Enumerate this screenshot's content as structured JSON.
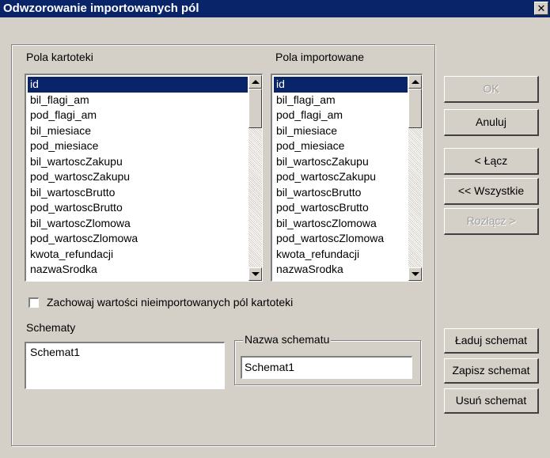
{
  "window": {
    "title": "Odwzorowanie importowanych pól",
    "close_glyph": "✕"
  },
  "fields_list": {
    "label": "Pola kartoteki",
    "items": [
      "id",
      "bil_flagi_am",
      "pod_flagi_am",
      "bil_miesiace",
      "pod_miesiace",
      "bil_wartoscZakupu",
      "pod_wartoscZakupu",
      "bil_wartoscBrutto",
      "pod_wartoscBrutto",
      "bil_wartoscZlomowa",
      "pod_wartoscZlomowa",
      "kwota_refundacji",
      "nazwaSrodka"
    ],
    "selected_index": 0
  },
  "imported_list": {
    "label": "Pola importowane",
    "items": [
      "id",
      "bil_flagi_am",
      "pod_flagi_am",
      "bil_miesiace",
      "pod_miesiace",
      "bil_wartoscZakupu",
      "pod_wartoscZakupu",
      "bil_wartoscBrutto",
      "pod_wartoscBrutto",
      "bil_wartoscZlomowa",
      "pod_wartoscZlomowa",
      "kwota_refundacji",
      "nazwaSrodka"
    ],
    "selected_index": 0
  },
  "keep_values_checkbox": {
    "label": "Zachowaj wartości nieimportowanych pól kartoteki",
    "checked": false
  },
  "schemas": {
    "label": "Schematy",
    "items": [
      "Schemat1"
    ]
  },
  "schema_name": {
    "legend": "Nazwa schematu",
    "value": "Schemat1"
  },
  "buttons": {
    "ok": "OK",
    "cancel": "Anuluj",
    "link": "< Łącz",
    "link_all": "<< Wszystkie",
    "unlink": "Rozłącz >",
    "load_schema": "Ładuj schemat",
    "save_schema": "Zapisz schemat",
    "delete_schema": "Usuń schemat"
  },
  "colors": {
    "face": "#d4d0c8",
    "titlebar": "#0a246a",
    "selection": "#0a246a"
  }
}
